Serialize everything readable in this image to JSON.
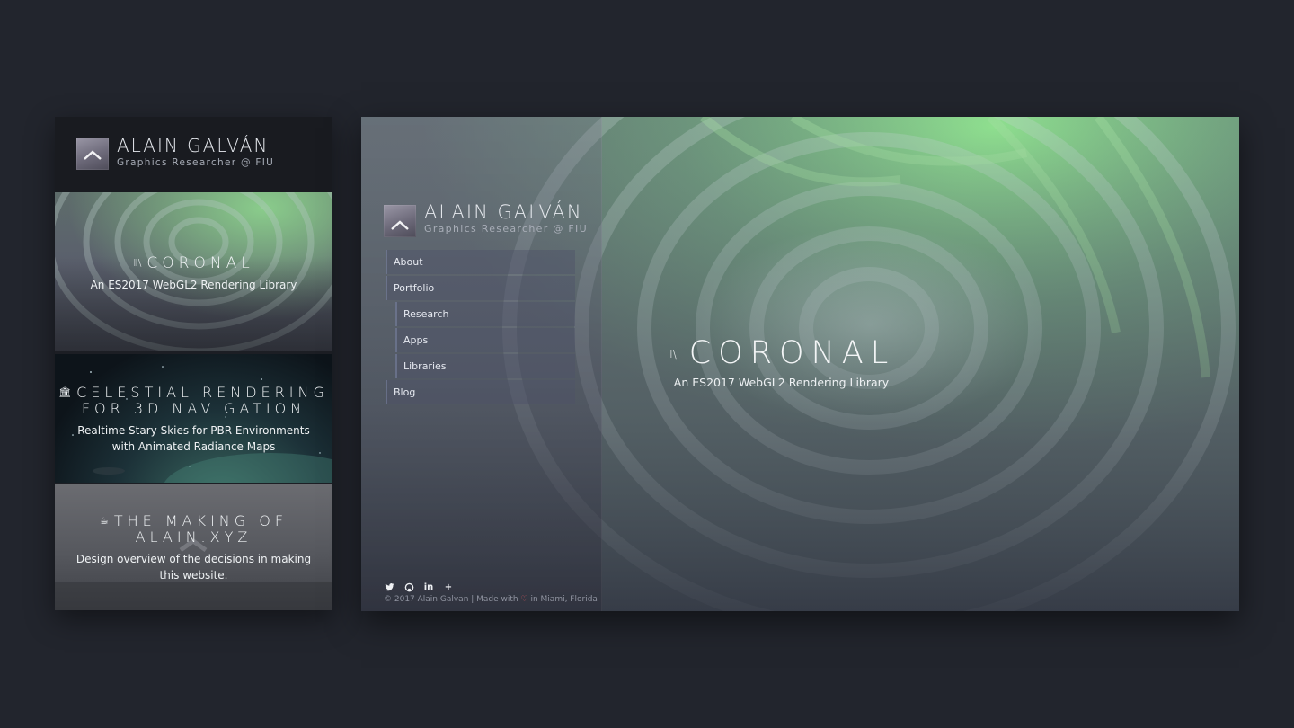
{
  "brand": {
    "name": "ALAIN GALVÁN",
    "tagline": "Graphics Researcher @ FIU"
  },
  "mobile": {
    "cards": [
      {
        "icon": "library-icon",
        "icon_glyph": "Ⅱ\\",
        "title": "CORONAL",
        "description": "An ES2017 WebGL2 Rendering Library"
      },
      {
        "icon": "institution-icon",
        "icon_glyph": "⏄",
        "title": "CELESTIAL RENDERING FOR 3D NAVIGATION",
        "description": "Realtime Stary Skies for PBR Environments with Animated Radiance Maps"
      },
      {
        "icon": "coffee-icon",
        "icon_glyph": "☕",
        "title": "THE MAKING OF ALAIN.XYZ",
        "description": "Design overview of the decisions in making this website."
      }
    ]
  },
  "sidebar": {
    "nav": [
      {
        "label": "About"
      },
      {
        "label": "Portfolio"
      },
      {
        "label": "Research"
      },
      {
        "label": "Apps"
      },
      {
        "label": "Libraries"
      },
      {
        "label": "Blog"
      }
    ],
    "social": [
      {
        "icon": "twitter-icon"
      },
      {
        "icon": "github-icon"
      },
      {
        "icon": "linkedin-icon",
        "glyph": "in"
      },
      {
        "icon": "plus-icon",
        "glyph": "+"
      }
    ],
    "footer": {
      "prefix": "© 2017 Alain Galvan | Made with",
      "heart": "♡",
      "suffix": "in Miami, Florida"
    }
  },
  "hero": {
    "icon": "library-icon",
    "title": "CORONAL",
    "subtitle": "An ES2017 WebGL2 Rendering Library"
  },
  "colors": {
    "page_background": "#22252d",
    "accent_green": "#7fdc8a",
    "heart": "#d0555f"
  }
}
